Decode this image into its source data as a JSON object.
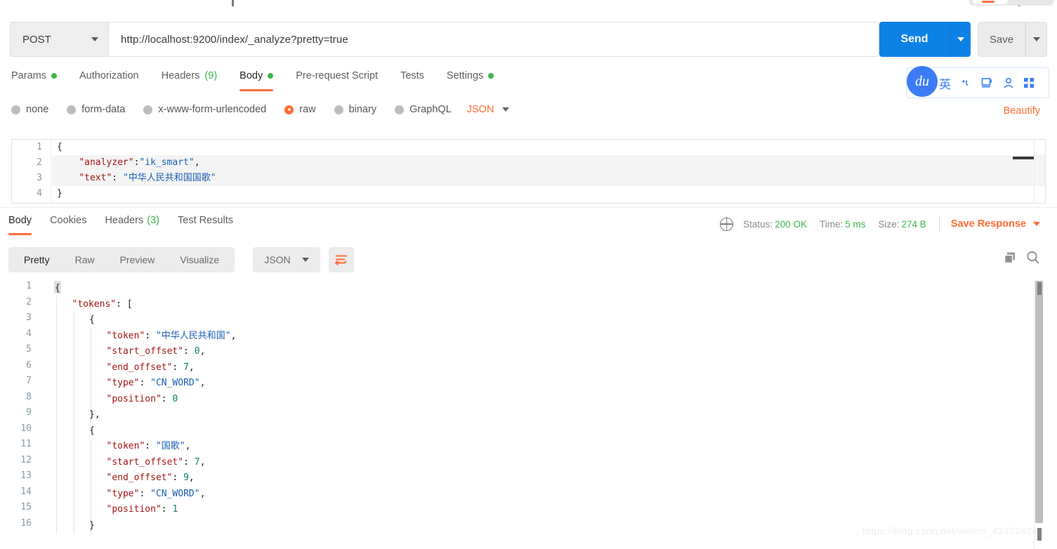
{
  "request": {
    "method": "POST",
    "url": "http://localhost:9200/index/_analyze?pretty=true",
    "send_label": "Send",
    "save_label": "Save",
    "tabs": [
      {
        "label": "Params",
        "dot": true,
        "count": "",
        "active": false
      },
      {
        "label": "Authorization",
        "dot": false,
        "count": "",
        "active": false
      },
      {
        "label": "Headers",
        "dot": false,
        "count": "(9)",
        "active": false
      },
      {
        "label": "Body",
        "dot": true,
        "count": "",
        "active": true
      },
      {
        "label": "Pre-request Script",
        "dot": false,
        "count": "",
        "active": false
      },
      {
        "label": "Tests",
        "dot": false,
        "count": "",
        "active": false
      },
      {
        "label": "Settings",
        "dot": true,
        "count": "",
        "active": false
      }
    ],
    "body_types": [
      {
        "label": "none",
        "selected": false
      },
      {
        "label": "form-data",
        "selected": false
      },
      {
        "label": "x-www-form-urlencoded",
        "selected": false
      },
      {
        "label": "raw",
        "selected": true
      },
      {
        "label": "binary",
        "selected": false
      },
      {
        "label": "GraphQL",
        "selected": false
      }
    ],
    "format": "JSON",
    "beautify_label": "Beautify",
    "editor_lines": [
      {
        "num": "1",
        "segments": [
          {
            "t": "{",
            "c": "p"
          }
        ]
      },
      {
        "num": "2",
        "segments": [
          {
            "t": "    ",
            "c": "p"
          },
          {
            "t": "\"analyzer\"",
            "c": "k"
          },
          {
            "t": ":",
            "c": "p"
          },
          {
            "t": "\"ik_smart\"",
            "c": "s"
          },
          {
            "t": ",",
            "c": "p"
          }
        ]
      },
      {
        "num": "3",
        "segments": [
          {
            "t": "    ",
            "c": "p"
          },
          {
            "t": "\"text\"",
            "c": "k"
          },
          {
            "t": ": ",
            "c": "p"
          },
          {
            "t": "\"中华人民共和国国歌\"",
            "c": "s"
          }
        ]
      },
      {
        "num": "4",
        "segments": [
          {
            "t": "}",
            "c": "p"
          }
        ]
      }
    ]
  },
  "extension": {
    "logo": "du",
    "lang": "英",
    "icons": [
      "voice-icon",
      "window-icon",
      "person-icon",
      "grid-icon"
    ]
  },
  "response": {
    "tabs": [
      {
        "label": "Body",
        "count": "",
        "active": true
      },
      {
        "label": "Cookies",
        "count": "",
        "active": false
      },
      {
        "label": "Headers",
        "count": "(3)",
        "active": false
      },
      {
        "label": "Test Results",
        "count": "",
        "active": false
      }
    ],
    "status_label": "Status:",
    "status_value": "200 OK",
    "time_label": "Time:",
    "time_value": "5 ms",
    "size_label": "Size:",
    "size_value": "274 B",
    "save_response_label": "Save Response",
    "view_modes": [
      {
        "label": "Pretty",
        "active": true
      },
      {
        "label": "Raw",
        "active": false
      },
      {
        "label": "Preview",
        "active": false
      },
      {
        "label": "Visualize",
        "active": false
      }
    ],
    "format": "JSON",
    "lines": [
      {
        "num": "1",
        "indent": 0,
        "segments": [
          {
            "t": "{",
            "c": "p"
          }
        ]
      },
      {
        "num": "2",
        "indent": 1,
        "segments": [
          {
            "t": "\"tokens\"",
            "c": "k"
          },
          {
            "t": ": [",
            "c": "p"
          }
        ]
      },
      {
        "num": "3",
        "indent": 2,
        "segments": [
          {
            "t": "{",
            "c": "p"
          }
        ]
      },
      {
        "num": "4",
        "indent": 3,
        "segments": [
          {
            "t": "\"token\"",
            "c": "k"
          },
          {
            "t": ": ",
            "c": "p"
          },
          {
            "t": "\"中华人民共和国\"",
            "c": "s"
          },
          {
            "t": ",",
            "c": "p"
          }
        ]
      },
      {
        "num": "5",
        "indent": 3,
        "segments": [
          {
            "t": "\"start_offset\"",
            "c": "k"
          },
          {
            "t": ": ",
            "c": "p"
          },
          {
            "t": "0",
            "c": "n"
          },
          {
            "t": ",",
            "c": "p"
          }
        ]
      },
      {
        "num": "6",
        "indent": 3,
        "segments": [
          {
            "t": "\"end_offset\"",
            "c": "k"
          },
          {
            "t": ": ",
            "c": "p"
          },
          {
            "t": "7",
            "c": "n"
          },
          {
            "t": ",",
            "c": "p"
          }
        ]
      },
      {
        "num": "7",
        "indent": 3,
        "segments": [
          {
            "t": "\"type\"",
            "c": "k"
          },
          {
            "t": ": ",
            "c": "p"
          },
          {
            "t": "\"CN_WORD\"",
            "c": "s"
          },
          {
            "t": ",",
            "c": "p"
          }
        ]
      },
      {
        "num": "8",
        "indent": 3,
        "segments": [
          {
            "t": "\"position\"",
            "c": "k"
          },
          {
            "t": ": ",
            "c": "p"
          },
          {
            "t": "0",
            "c": "n"
          }
        ]
      },
      {
        "num": "9",
        "indent": 2,
        "segments": [
          {
            "t": "},",
            "c": "p"
          }
        ]
      },
      {
        "num": "10",
        "indent": 2,
        "segments": [
          {
            "t": "{",
            "c": "p"
          }
        ]
      },
      {
        "num": "11",
        "indent": 3,
        "segments": [
          {
            "t": "\"token\"",
            "c": "k"
          },
          {
            "t": ": ",
            "c": "p"
          },
          {
            "t": "\"国歌\"",
            "c": "s"
          },
          {
            "t": ",",
            "c": "p"
          }
        ]
      },
      {
        "num": "12",
        "indent": 3,
        "segments": [
          {
            "t": "\"start_offset\"",
            "c": "k"
          },
          {
            "t": ": ",
            "c": "p"
          },
          {
            "t": "7",
            "c": "n"
          },
          {
            "t": ",",
            "c": "p"
          }
        ]
      },
      {
        "num": "13",
        "indent": 3,
        "segments": [
          {
            "t": "\"end_offset\"",
            "c": "k"
          },
          {
            "t": ": ",
            "c": "p"
          },
          {
            "t": "9",
            "c": "n"
          },
          {
            "t": ",",
            "c": "p"
          }
        ]
      },
      {
        "num": "14",
        "indent": 3,
        "segments": [
          {
            "t": "\"type\"",
            "c": "k"
          },
          {
            "t": ": ",
            "c": "p"
          },
          {
            "t": "\"CN_WORD\"",
            "c": "s"
          },
          {
            "t": ",",
            "c": "p"
          }
        ]
      },
      {
        "num": "15",
        "indent": 3,
        "segments": [
          {
            "t": "\"position\"",
            "c": "k"
          },
          {
            "t": ": ",
            "c": "p"
          },
          {
            "t": "1",
            "c": "n"
          }
        ]
      },
      {
        "num": "16",
        "indent": 2,
        "segments": [
          {
            "t": "}",
            "c": "p"
          }
        ]
      }
    ]
  },
  "watermark": "https://blog.csdn.net/weixin_43452424"
}
